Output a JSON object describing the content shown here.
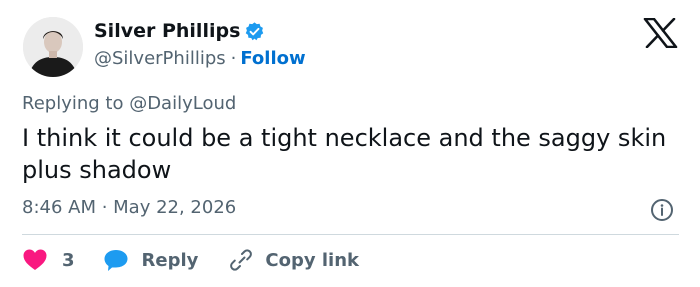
{
  "author": {
    "display_name": "Silver Phillips",
    "handle": "@SilverPhillips",
    "separator": "·",
    "follow_label": "Follow"
  },
  "reply_context": "Replying to @DailyLoud",
  "tweet": {
    "text": "I think it could be a tight necklace and the saggy skin plus shadow",
    "timestamp": "8:46 AM · May 22, 2026"
  },
  "actions": {
    "like_count": "3",
    "reply_label": "Reply",
    "copy_label": "Copy link"
  },
  "colors": {
    "text": "#0f1419",
    "secondary": "#536471",
    "link": "#0070d0",
    "like": "#f91880",
    "reply_icon": "#1d9bf0"
  },
  "icons": [
    "verified-badge-icon",
    "x-logo-icon",
    "info-icon",
    "heart-icon",
    "reply-bubble-icon",
    "link-icon"
  ]
}
